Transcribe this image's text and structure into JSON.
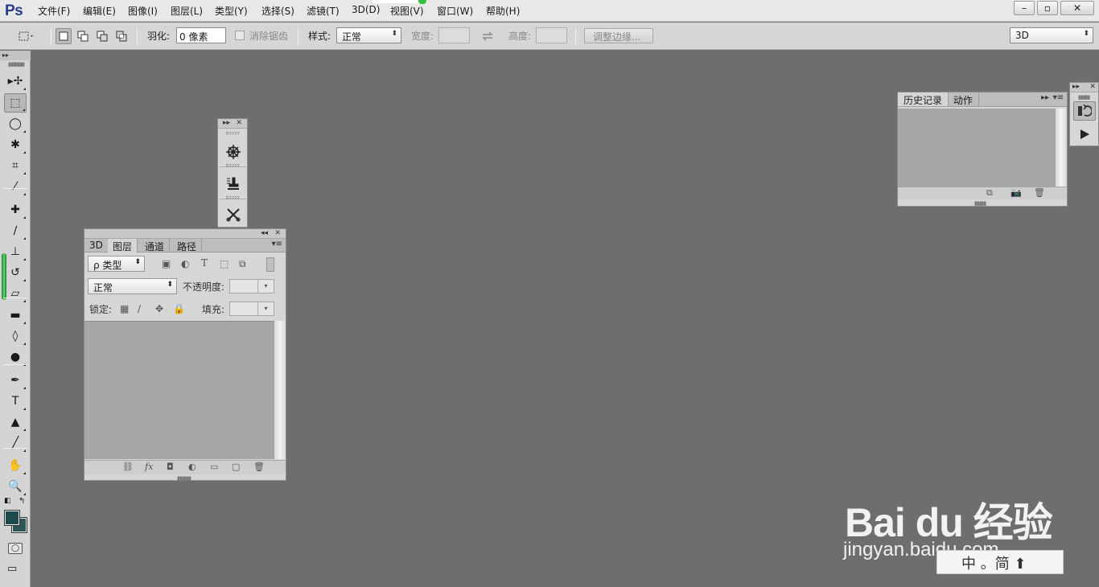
{
  "app": {
    "logo": "Ps"
  },
  "menubar": {
    "items": [
      "文件(F)",
      "编辑(E)",
      "图像(I)",
      "图层(L)",
      "类型(Y)",
      "选择(S)",
      "滤镜(T)",
      "3D(D)",
      "视图(V)",
      "窗口(W)",
      "帮助(H)"
    ],
    "window_controls": {
      "minimize": "–",
      "restore": "▫",
      "close": "✕"
    }
  },
  "options_bar": {
    "feather_label": "羽化:",
    "feather_value": "0 像素",
    "antialias_label": "消除锯齿",
    "style_label": "样式:",
    "style_value": "正常",
    "width_label": "宽度:",
    "height_label": "高度:",
    "refine_edge_button": "调整边缘...",
    "workspace_value": "3D"
  },
  "toolbar": {
    "tools": [
      {
        "name": "move-tool",
        "icon": "▸✢"
      },
      {
        "name": "rect-marquee-tool",
        "icon": "⬚",
        "active": true
      },
      {
        "name": "lasso-tool",
        "icon": "◯"
      },
      {
        "name": "magic-wand-tool",
        "icon": "✱"
      },
      {
        "name": "crop-tool",
        "icon": "⌗"
      },
      {
        "name": "eyedropper-tool",
        "icon": "⁄"
      },
      {
        "name": "healing-brush-tool",
        "icon": "✚"
      },
      {
        "name": "brush-tool",
        "icon": "∕"
      },
      {
        "name": "clone-stamp-tool",
        "icon": "⊥"
      },
      {
        "name": "history-brush-tool",
        "icon": "↺"
      },
      {
        "name": "eraser-tool",
        "icon": "▱"
      },
      {
        "name": "gradient-tool",
        "icon": "▬"
      },
      {
        "name": "blur-tool",
        "icon": "◊"
      },
      {
        "name": "dodge-tool",
        "icon": "●"
      },
      {
        "name": "pen-tool",
        "icon": "✒"
      },
      {
        "name": "type-tool",
        "icon": "T"
      },
      {
        "name": "path-selection-tool",
        "icon": "▲"
      },
      {
        "name": "line-tool",
        "icon": "╱"
      },
      {
        "name": "hand-tool",
        "icon": "✋"
      },
      {
        "name": "zoom-tool",
        "icon": "🔍"
      }
    ]
  },
  "layers_panel": {
    "tabs": [
      "3D",
      "图层",
      "通道",
      "路径"
    ],
    "active_tab": "图层",
    "kind_filter": "ρ 类型",
    "blend_mode": "正常",
    "opacity_label": "不透明度:",
    "lock_label": "锁定:",
    "fill_label": "填充:"
  },
  "history_panel": {
    "tabs": [
      "历史记录",
      "动作"
    ],
    "active_tab": "历史记录"
  },
  "watermark": {
    "brand": "Bai du 经验",
    "url": "jingyan.baidu.com",
    "badge": "中 。简 ⬆"
  }
}
